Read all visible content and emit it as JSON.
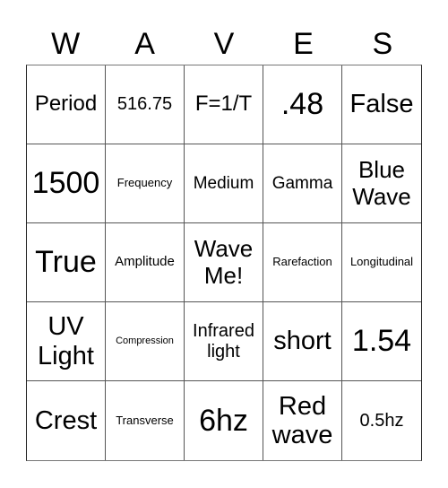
{
  "title_letters": [
    "W",
    "A",
    "V",
    "E",
    "S"
  ],
  "cells": [
    [
      "Period",
      "516.75",
      "F=1/T",
      ".48",
      "False"
    ],
    [
      "1500",
      "Frequency",
      "Medium",
      "Gamma",
      "Blue Wave"
    ],
    [
      "True",
      "Amplitude",
      "Wave Me!",
      "Rarefaction",
      "Longitudinal"
    ],
    [
      "UV Light",
      "Compression",
      "Infrared light",
      "short",
      "1.54"
    ],
    [
      "Crest",
      "Transverse",
      "6hz",
      "Red wave",
      "0.5hz"
    ]
  ],
  "free_space": "Wave Me!"
}
